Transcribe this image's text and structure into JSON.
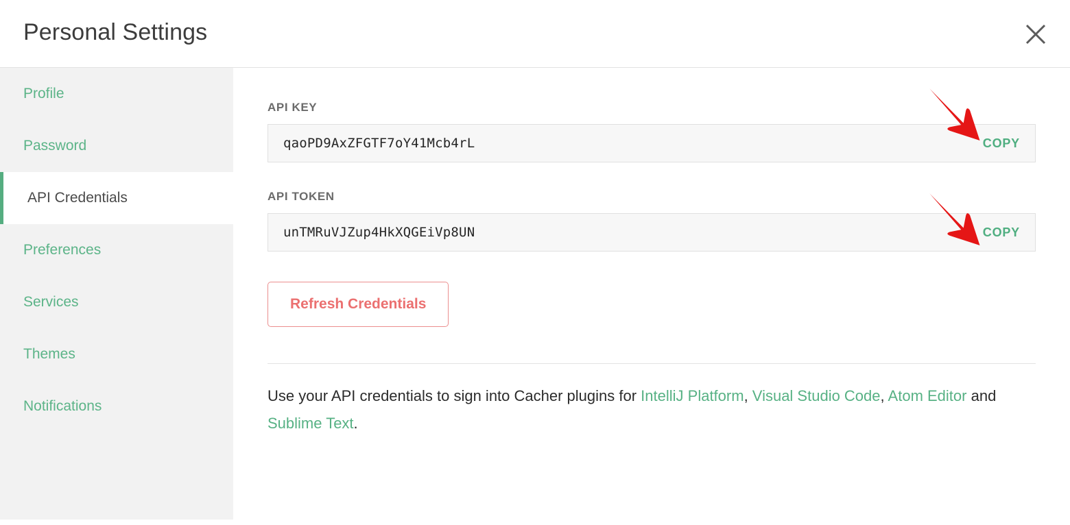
{
  "header": {
    "title": "Personal Settings",
    "close_icon": "close-icon"
  },
  "sidebar": {
    "items": [
      {
        "label": "Profile",
        "active": false
      },
      {
        "label": "Password",
        "active": false
      },
      {
        "label": "API Credentials",
        "active": true
      },
      {
        "label": "Preferences",
        "active": false
      },
      {
        "label": "Services",
        "active": false
      },
      {
        "label": "Themes",
        "active": false
      },
      {
        "label": "Notifications",
        "active": false
      }
    ]
  },
  "main": {
    "api_key": {
      "label": "API KEY",
      "value": "qaoPD9AxZFGTF7oY41Mcb4rL",
      "copy_label": "COPY"
    },
    "api_token": {
      "label": "API TOKEN",
      "value": "unTMRuVJZup4HkXQGEiVp8UN",
      "copy_label": "COPY"
    },
    "refresh_button": "Refresh Credentials",
    "footer": {
      "part1": "Use your API credentials to sign into Cacher plugins for ",
      "link1": "IntelliJ Platform",
      "sep1": ", ",
      "link2": "Visual Studio Code",
      "sep2": ", ",
      "link3": "Atom Editor",
      "sep3": " and ",
      "link4": "Sublime Text",
      "end": "."
    }
  },
  "annotations": {
    "arrow_color": "#e51616",
    "arrow_1_target": "copy-api-key-button",
    "arrow_2_target": "copy-api-token-button"
  },
  "colors": {
    "accent_green": "#57b184",
    "danger_red": "#eb7070",
    "sidebar_bg": "#f2f2f2",
    "field_bg": "#f7f7f7"
  }
}
